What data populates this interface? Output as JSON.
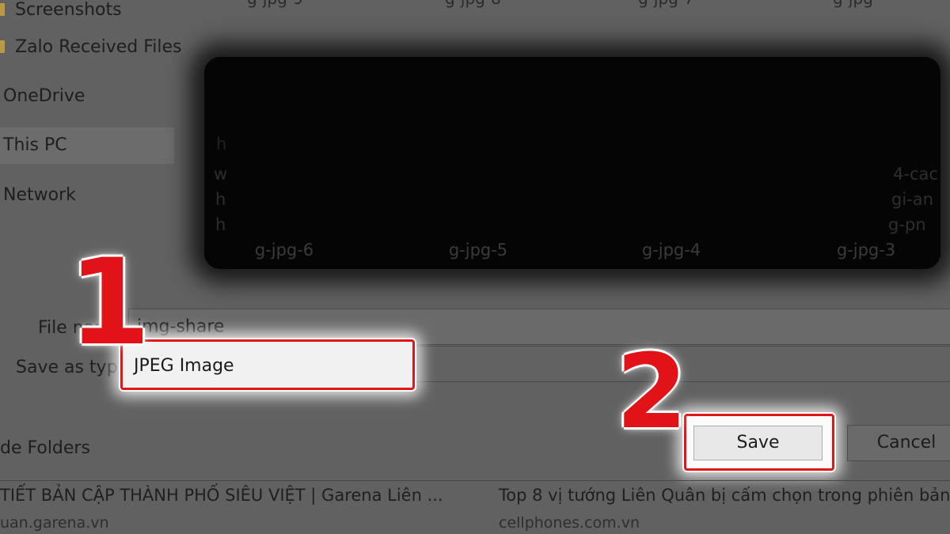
{
  "nav": {
    "items": [
      {
        "label": "Screenshots",
        "sub": true
      },
      {
        "label": "Zalo Received Files",
        "sub": true
      },
      {
        "label": "OneDrive",
        "sub": false
      },
      {
        "label": "This PC",
        "sub": false,
        "selected": true
      },
      {
        "label": "Network",
        "sub": false
      }
    ]
  },
  "files": {
    "top_labels": [
      "g-jpg-9",
      "g-jpg-8",
      "g-jpg-7",
      "g-jpg-"
    ],
    "labels": [
      "g-jpg-6",
      "g-jpg-5",
      "g-jpg-4",
      "g-jpg-3"
    ],
    "left_fragments": [
      "w",
      "h",
      "h"
    ],
    "right_fragments": [
      "4-cac",
      "gi-an",
      "g-pn"
    ],
    "overlay_fragment": "h"
  },
  "form": {
    "file_name_label": "File name:",
    "file_name_value": "img-share",
    "save_type_label": "Save as type:",
    "save_type_value": "JPEG Image",
    "hide_folders": "de Folders"
  },
  "buttons": {
    "save": "Save",
    "cancel": "Cancel"
  },
  "annotations": {
    "step1": "1",
    "step2": "2",
    "highlight_color": "#e0161a"
  },
  "results": [
    {
      "title": "TIẾT BẢN CẬP THÀNH PHỐ SIÊU VIỆT | Garena Liên ...",
      "url": "uan.garena.vn"
    },
    {
      "title": "Top 8 vị tướng Liên Quân bị cấm chọn trong phiên bản",
      "url": "cellphones.com.vn"
    }
  ]
}
